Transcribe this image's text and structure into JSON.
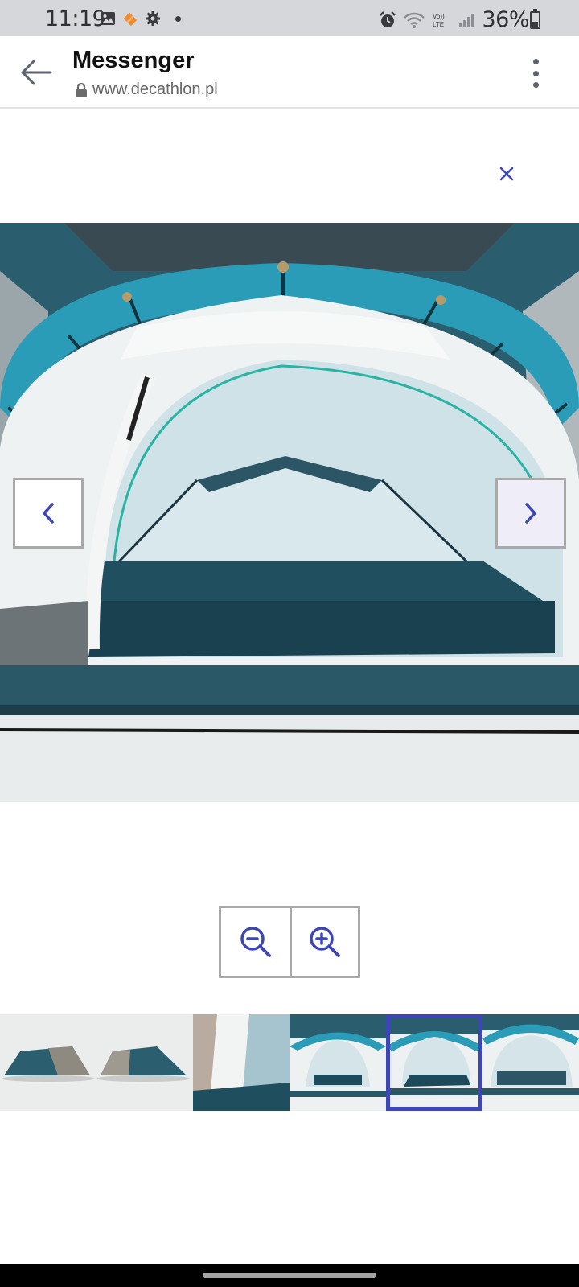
{
  "status_bar": {
    "time": "11:19",
    "battery_text": "36%",
    "battery_level": 0.36,
    "icons": [
      "gallery-icon",
      "app-notification-icon",
      "settings-icon",
      "dot-icon",
      "alarm-icon",
      "wifi-icon",
      "volte-icon",
      "signal-icon",
      "battery-icon"
    ]
  },
  "header": {
    "title": "Messenger",
    "url": "www.decathlon.pl",
    "icons": [
      "back-arrow-icon",
      "lock-icon",
      "more-vert-icon"
    ]
  },
  "viewer": {
    "close_icon": "close-icon",
    "prev_icon": "chevron-left-icon",
    "next_icon": "chevron-right-icon",
    "zoom_out_icon": "zoom-out-icon",
    "zoom_in_icon": "zoom-in-icon",
    "thumbnail_count": 5,
    "selected_thumbnail": 4
  },
  "colors": {
    "accent": "#3c46b8",
    "tent_teal": "#2b9cb7",
    "tent_dark": "#1d4a5a",
    "status_bar_bg": "#d6d7db"
  }
}
